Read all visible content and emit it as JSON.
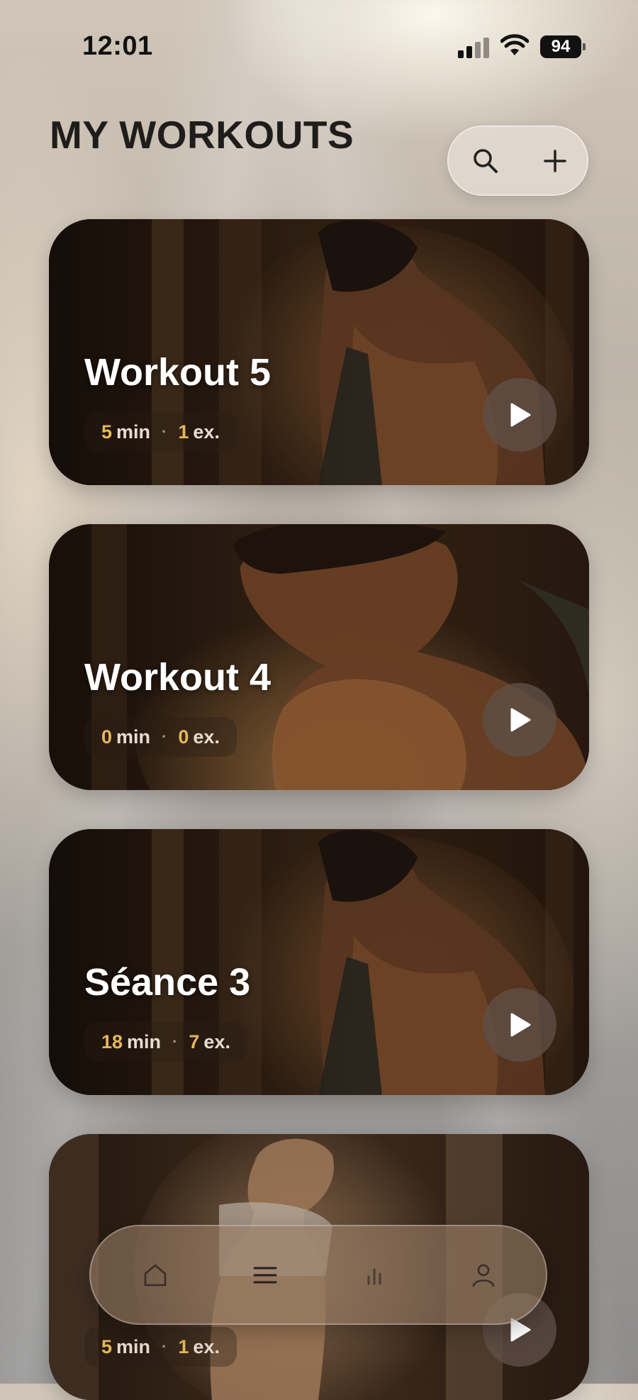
{
  "status_bar": {
    "time": "12:01",
    "battery": "94"
  },
  "header": {
    "title": "MY WORKOUTS"
  },
  "actions": {
    "search_icon": "search-icon",
    "add_icon": "plus-icon"
  },
  "workouts": [
    {
      "title": "Workout 5",
      "minutes": "5",
      "min_unit": "min",
      "exercises": "1",
      "ex_unit": "ex."
    },
    {
      "title": "Workout 4",
      "minutes": "0",
      "min_unit": "min",
      "exercises": "0",
      "ex_unit": "ex."
    },
    {
      "title": "Séance 3",
      "minutes": "18",
      "min_unit": "min",
      "exercises": "7",
      "ex_unit": "ex."
    },
    {
      "title": "",
      "minutes": "5",
      "min_unit": "min",
      "exercises": "1",
      "ex_unit": "ex."
    }
  ],
  "tab_bar": {
    "items": [
      "home-icon",
      "list-icon",
      "stats-icon",
      "profile-icon"
    ]
  },
  "colors": {
    "accent": "#e6b65a",
    "title": "#1f1d1b"
  }
}
